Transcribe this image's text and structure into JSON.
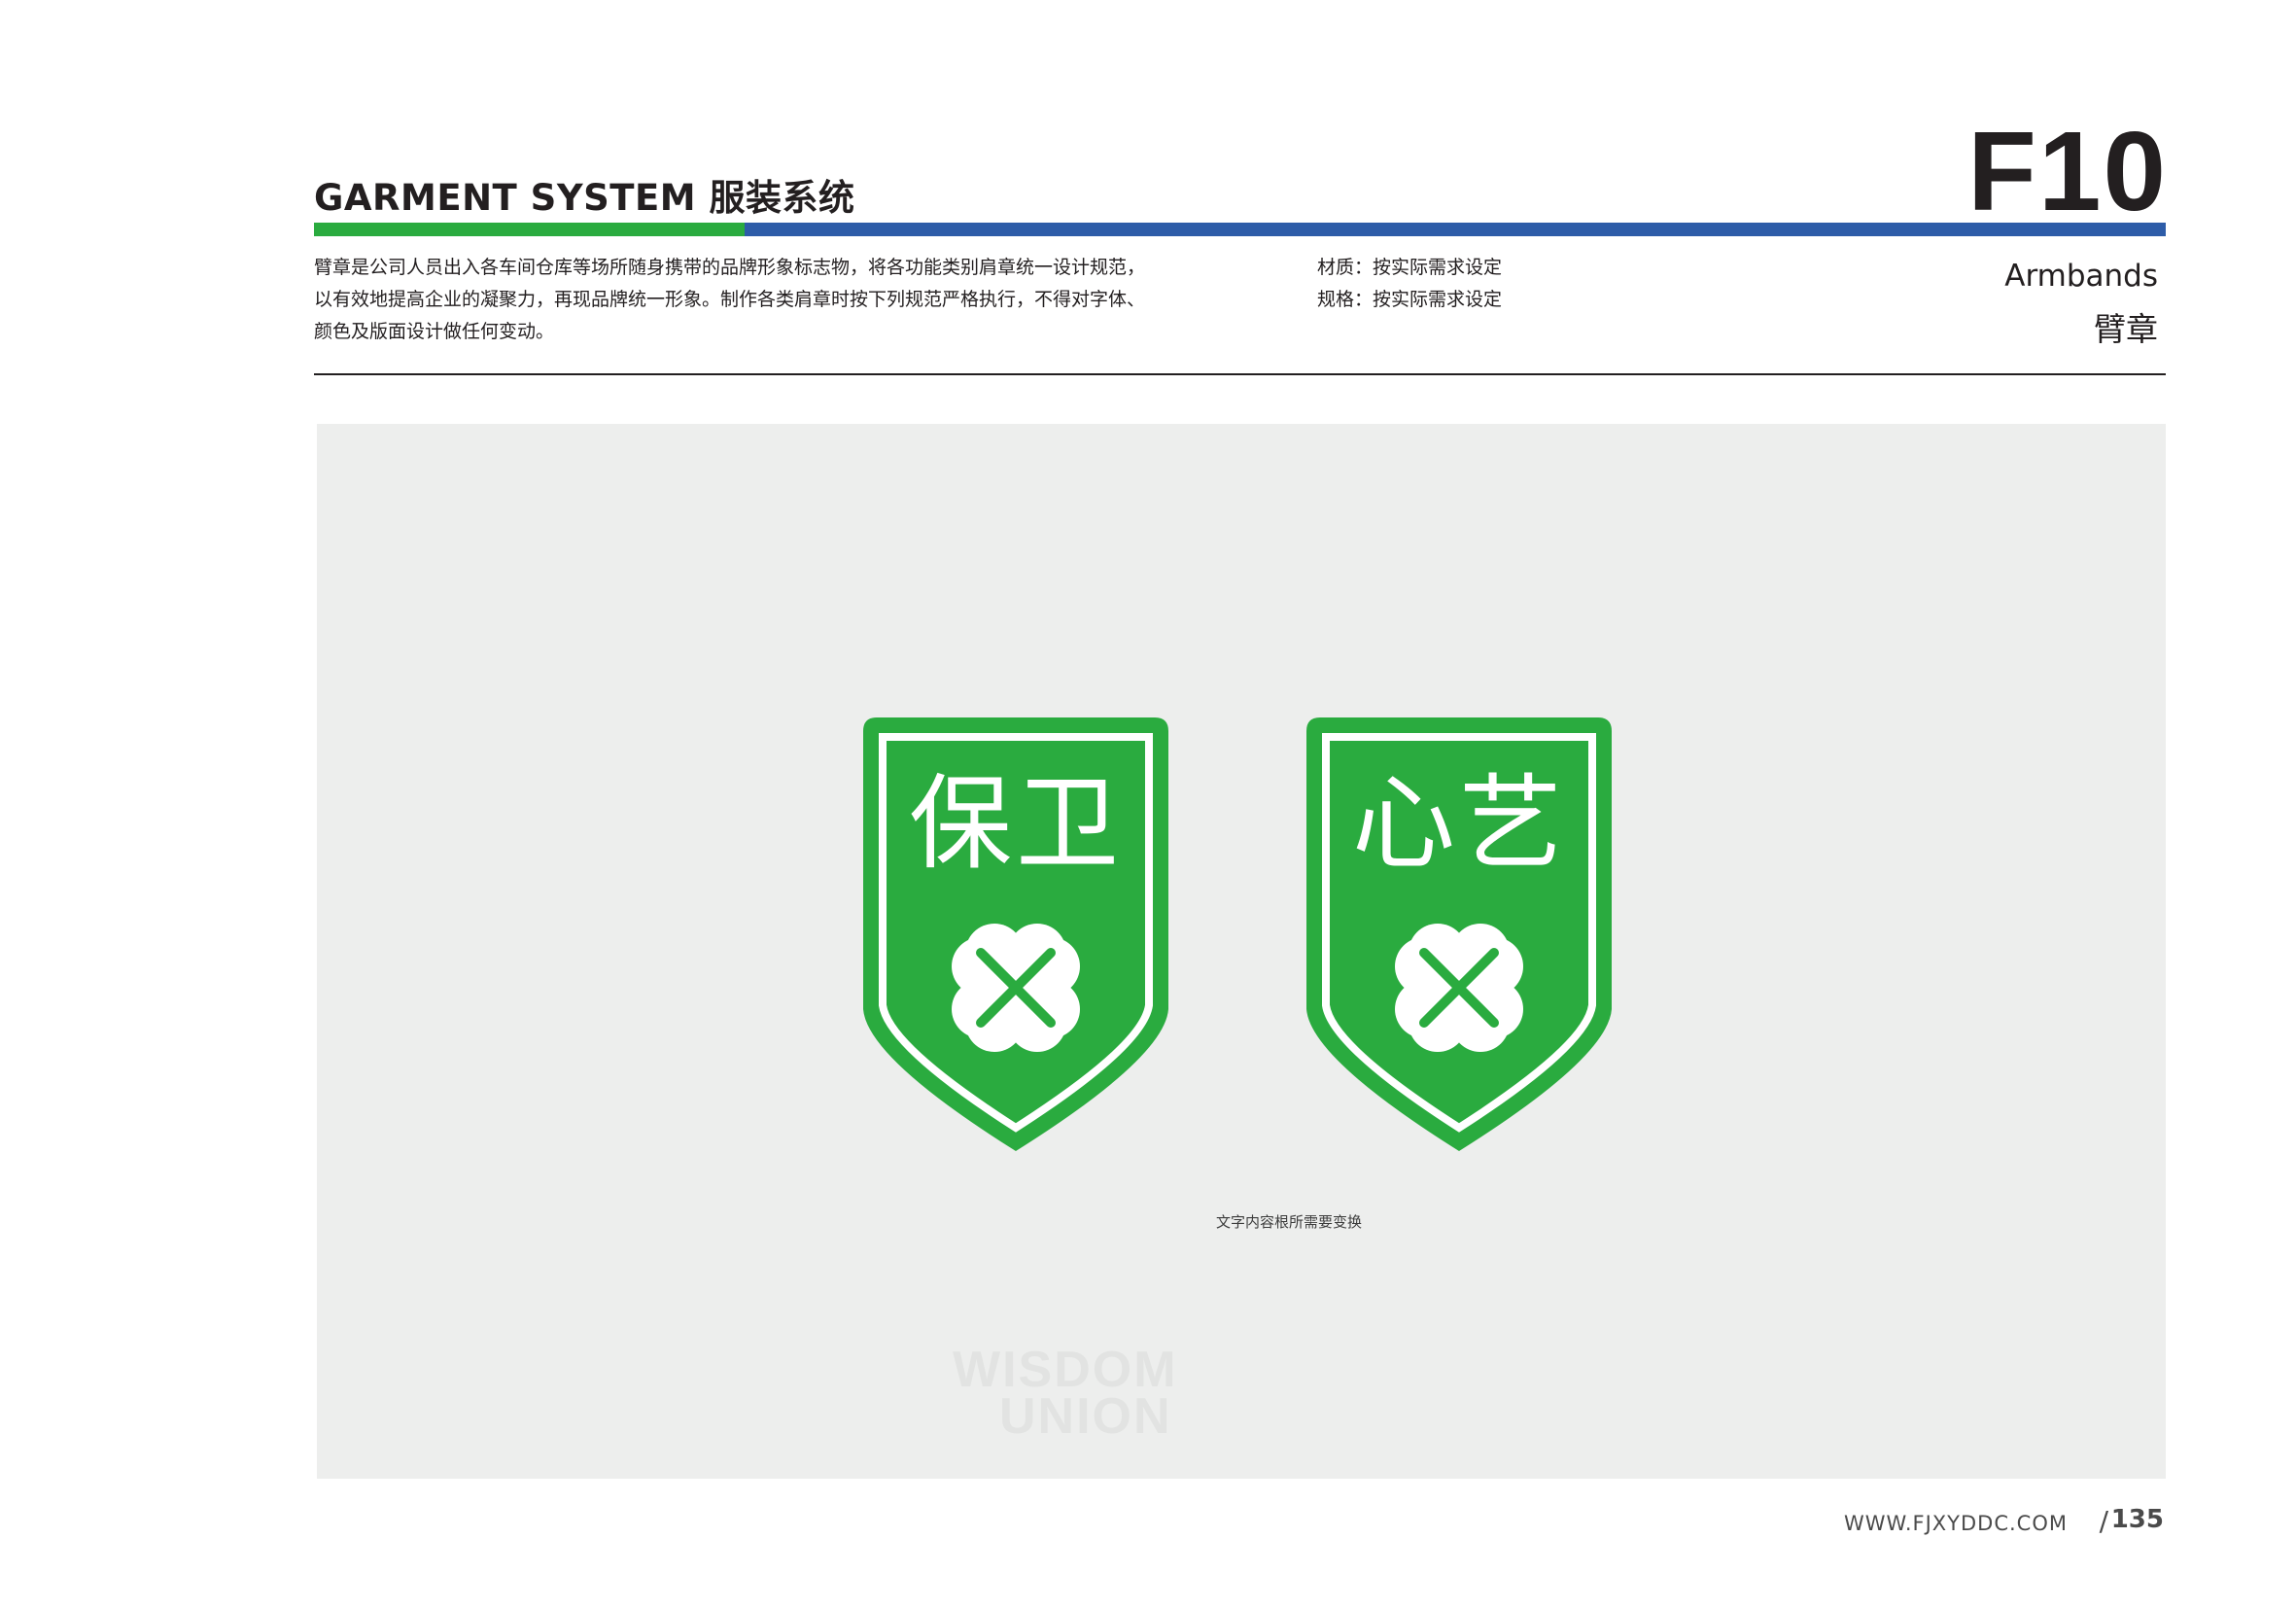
{
  "header": {
    "section_title": "GARMENT SYSTEM 服装系统",
    "page_code": "F10",
    "title_en": "Armbands",
    "title_cn": "臂章"
  },
  "description": {
    "lines": [
      "臂章是公司人员出入各车间仓库等场所随身携带的品牌形象标志物，将各功能类别肩章统一设计规范，",
      "以有效地提高企业的凝聚力，再现品牌统一形象。制作各类肩章时按下列规范严格执行，不得对字体、",
      "颜色及版面设计做任何变动。"
    ]
  },
  "spec": {
    "material": "材质：按实际需求设定",
    "size": "规格：按实际需求设定"
  },
  "badges": [
    {
      "label": "保卫"
    },
    {
      "label": "心艺"
    }
  ],
  "colors": {
    "brand_green": "#2aab3f",
    "brand_blue": "#2d5ca8",
    "panel_bg": "#edeeed"
  },
  "caption": "文字内容根所需要变换",
  "watermark": {
    "line1": "WISDOM",
    "line2": "UNION"
  },
  "footer": {
    "url": "WWW.FJXYDDC.COM",
    "page_number": "135"
  }
}
